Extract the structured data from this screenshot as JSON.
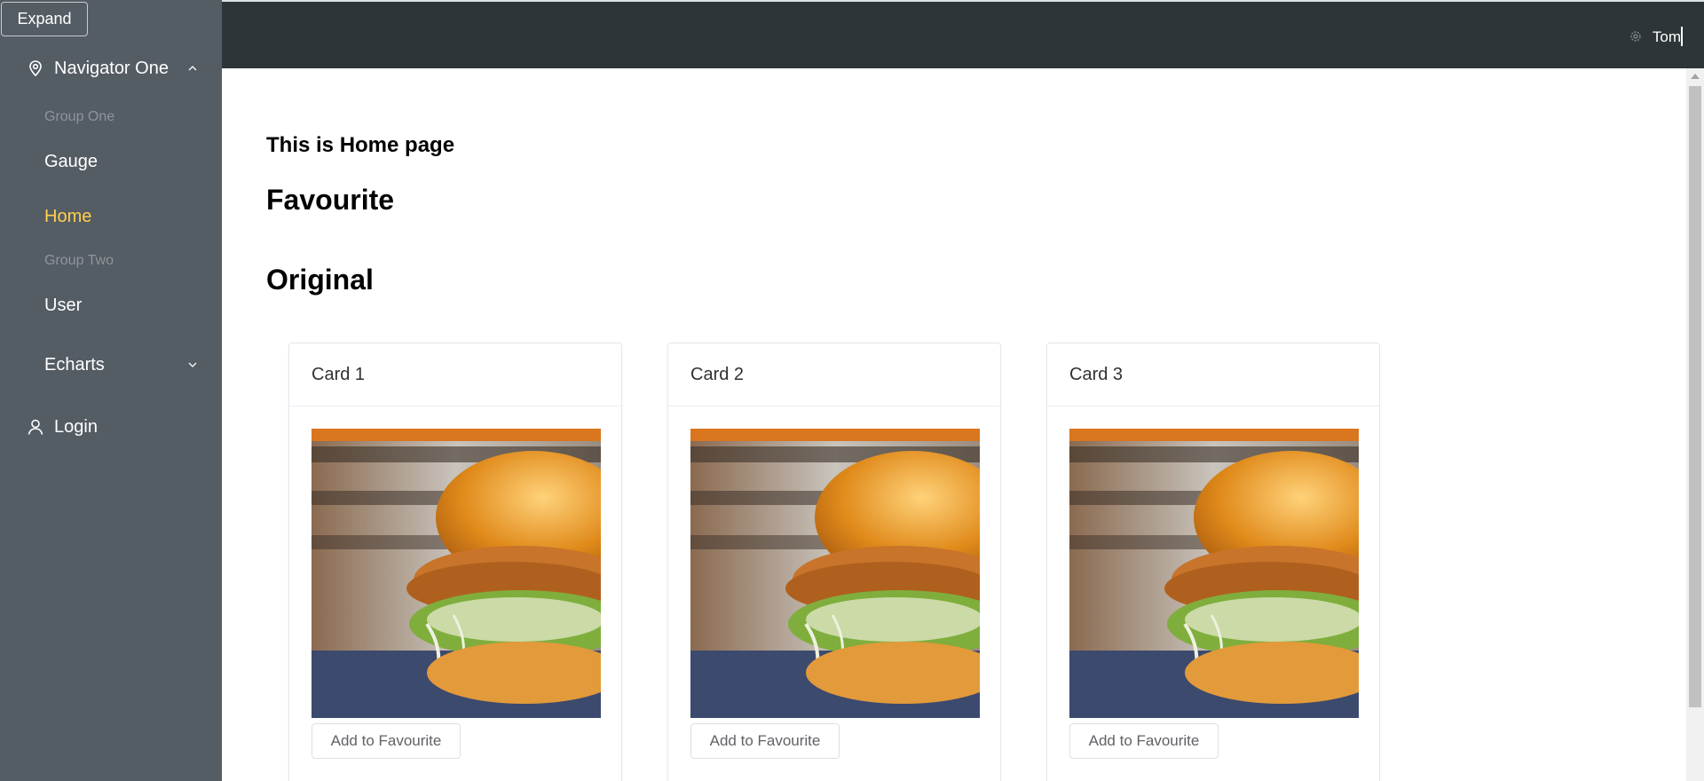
{
  "sidebar": {
    "expand_label": "Expand",
    "navigator_one": {
      "label": "Navigator One",
      "icon": "location-pin-icon"
    },
    "group_one": "Group One",
    "gauge": "Gauge",
    "home": "Home",
    "group_two": "Group Two",
    "user": "User",
    "echarts": "Echarts",
    "login": {
      "label": "Login",
      "icon": "user-icon"
    },
    "colors": {
      "background": "#545c64",
      "active_text": "#ffd04b",
      "group_text": "#8f959b"
    }
  },
  "header": {
    "username": "Tom",
    "icon": "gear-icon",
    "background": "#2e3538"
  },
  "main": {
    "page_title": "This is Home page",
    "favourite_heading": "Favourite",
    "original_heading": "Original",
    "cards": [
      {
        "title": "Card 1",
        "button": "Add to Favourite",
        "image": "chicken-burger-image"
      },
      {
        "title": "Card 2",
        "button": "Add to Favourite",
        "image": "chicken-burger-image"
      },
      {
        "title": "Card 3",
        "button": "Add to Favourite",
        "image": "chicken-burger-image"
      }
    ]
  }
}
